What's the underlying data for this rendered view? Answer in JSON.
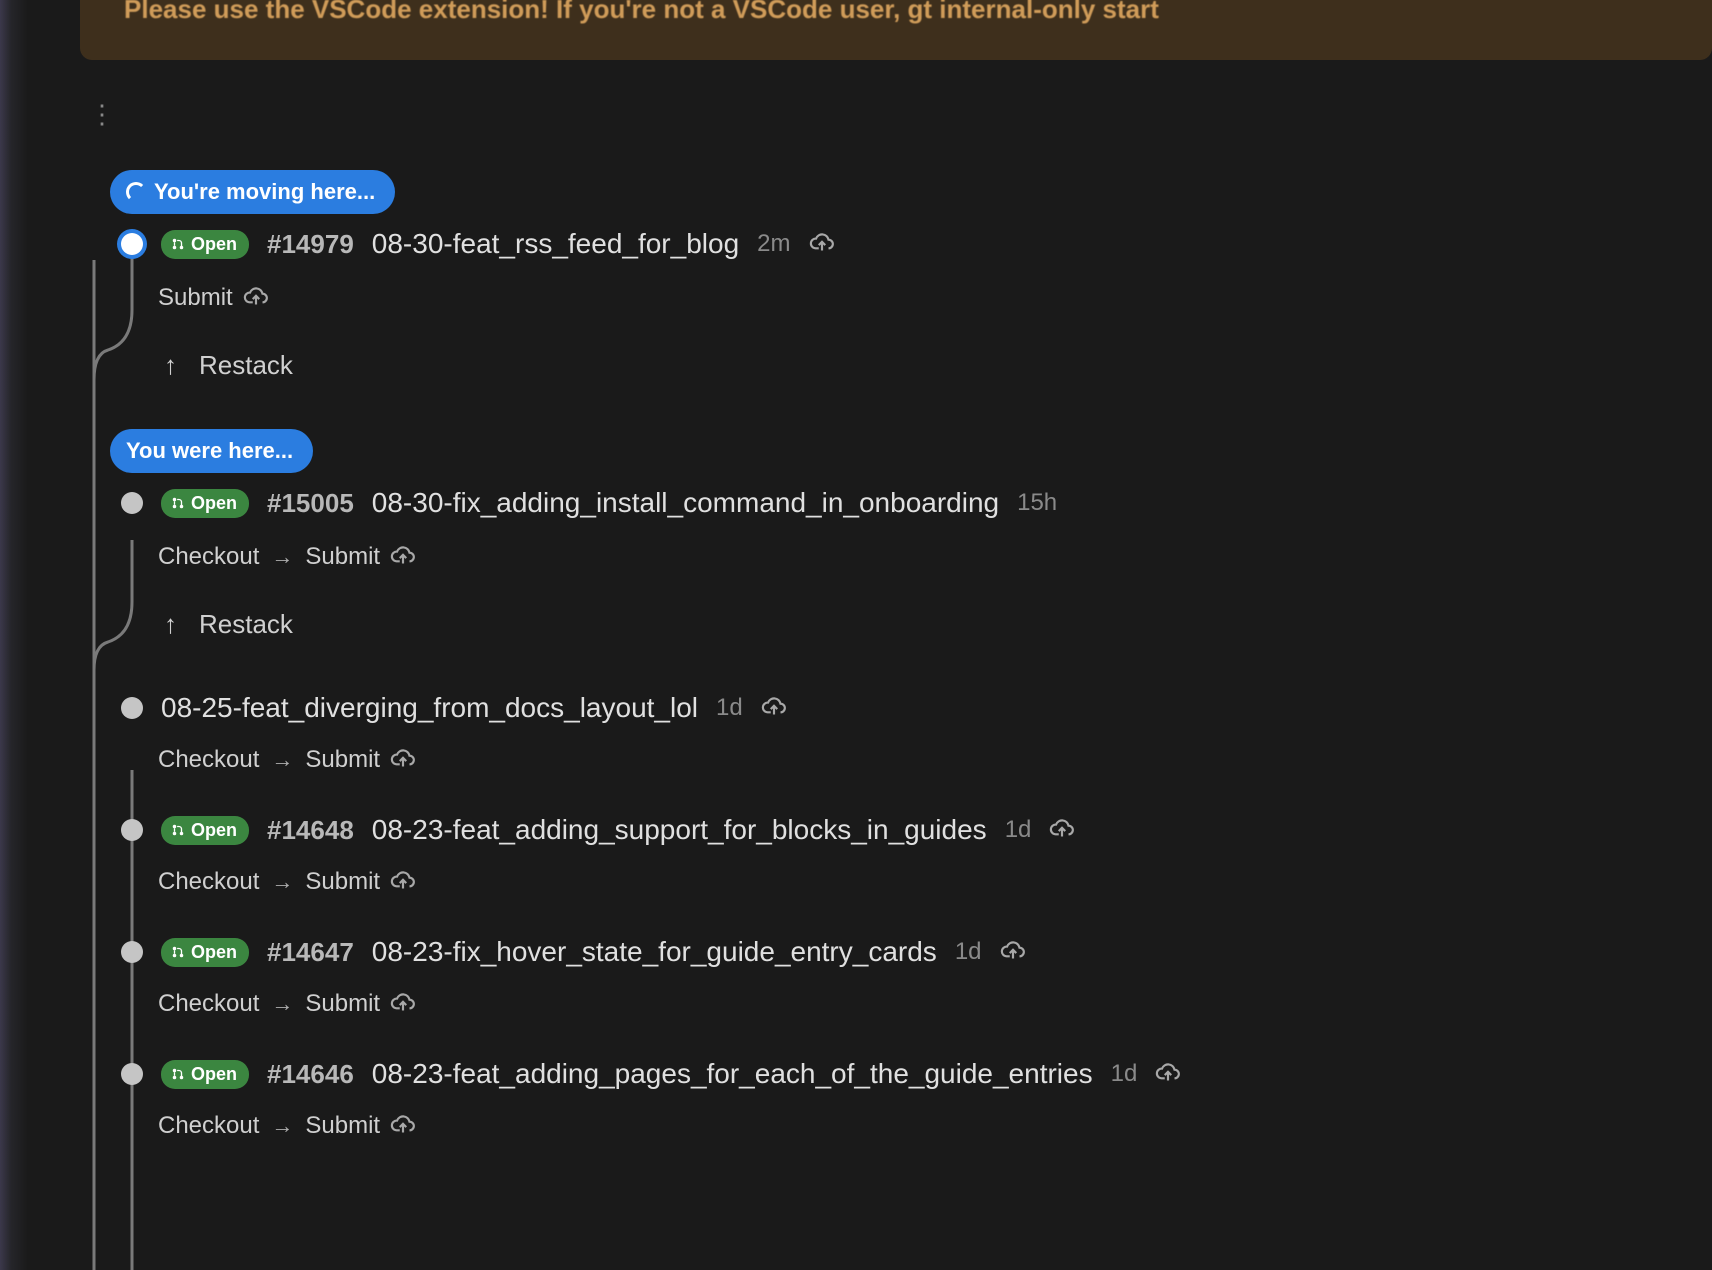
{
  "banner": {
    "text": "Please use the VSCode extension! If you're not a VSCode user, gt internal-only start"
  },
  "tooltips": {
    "moving_here": "You're moving here...",
    "were_here": "You were here..."
  },
  "status_label": "Open",
  "actions": {
    "submit": "Submit",
    "checkout": "Checkout",
    "restack": "Restack"
  },
  "branches": {
    "target": {
      "pr": "#14979",
      "name": "08-30-feat_rss_feed_for_blog",
      "time": "2m",
      "has_status": true
    },
    "previous": {
      "pr": "#15005",
      "name": "08-30-fix_adding_install_command_in_onboarding",
      "time": "15h",
      "has_status": true
    },
    "list": [
      {
        "pr": "",
        "name": "08-25-feat_diverging_from_docs_layout_lol",
        "time": "1d",
        "has_status": false
      },
      {
        "pr": "#14648",
        "name": "08-23-feat_adding_support_for_blocks_in_guides",
        "time": "1d",
        "has_status": true
      },
      {
        "pr": "#14647",
        "name": "08-23-fix_hover_state_for_guide_entry_cards",
        "time": "1d",
        "has_status": true
      },
      {
        "pr": "#14646",
        "name": "08-23-feat_adding_pages_for_each_of_the_guide_entries",
        "time": "1d",
        "has_status": true
      }
    ]
  }
}
